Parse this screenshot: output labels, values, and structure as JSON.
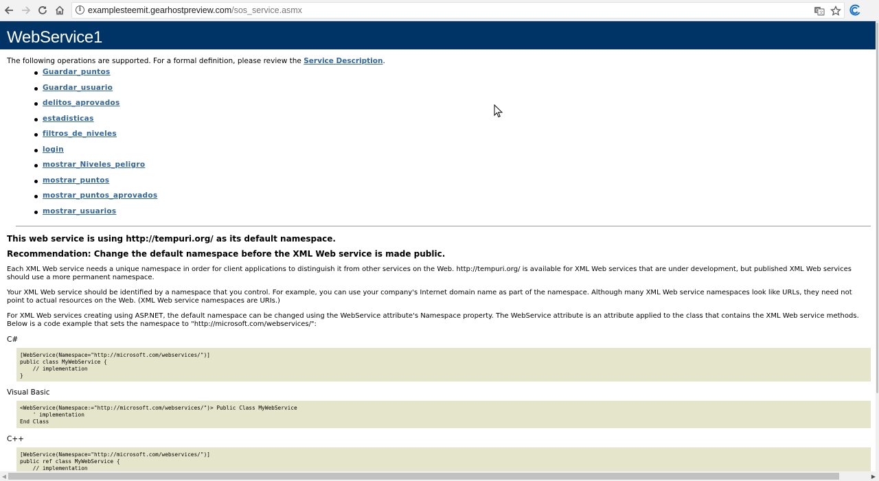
{
  "browser": {
    "url_host": "examplesteemit.gearhostpreview.com",
    "url_path": "/sos_service.asmx"
  },
  "page": {
    "title": "WebService1",
    "intro_text": "The following operations are supported. For a formal definition, please review the ",
    "intro_link": "Service Description",
    "intro_end": ".",
    "operations": [
      "Guardar_puntos",
      "Guardar_usuario",
      "delitos_aprovados",
      "estadisticas",
      "filtros_de_niveles",
      "login",
      "mostrar_Niveles_peligro",
      "mostrar_puntos",
      "mostrar_puntos_aprovados",
      "mostrar_usuarios"
    ],
    "namespace_heading": "This web service is using http://tempuri.org/ as its default namespace.",
    "recommendation_heading": "Recommendation: Change the default namespace before the XML Web service is made public.",
    "para1": "Each XML Web service needs a unique namespace in order for client applications to distinguish it from other services on the Web. http://tempuri.org/ is available for XML Web services that are under development, but published XML Web services should use a more permanent namespace.",
    "para2": "Your XML Web service should be identified by a namespace that you control. For example, you can use your company's Internet domain name as part of the namespace. Although many XML Web service namespaces look like URLs, they need not point to actual resources on the Web. (XML Web service namespaces are URIs.)",
    "para3": "For XML Web services creating using ASP.NET, the default namespace can be changed using the WebService attribute's Namespace property. The WebService attribute is an attribute applied to the class that contains the XML Web service methods. Below is a code example that sets the namespace to \"http://microsoft.com/webservices/\":",
    "csharp_label": "C#",
    "csharp_code": "[WebService(Namespace=\"http://microsoft.com/webservices/\")]\npublic class MyWebService {\n    // implementation\n}",
    "vb_label": "Visual Basic",
    "vb_code": "<WebService(Namespace:=\"http://microsoft.com/webservices/\")> Public Class MyWebService\n    ' implementation\nEnd Class",
    "cpp_label": "C++",
    "cpp_code": "[WebService(Namespace=\"http://microsoft.com/webservices/\")]\npublic ref class MyWebService {\n    // implementation\n}"
  },
  "icons": {
    "back": "back-arrow-icon",
    "forward": "forward-arrow-icon",
    "reload": "reload-icon",
    "home": "home-icon",
    "info": "info-icon",
    "translate": "translate-icon",
    "bookmark": "star-icon",
    "extension": "extension-icon"
  },
  "colors": {
    "header_bg": "#003366",
    "link": "#336699",
    "code_bg": "#e5e5cc"
  }
}
